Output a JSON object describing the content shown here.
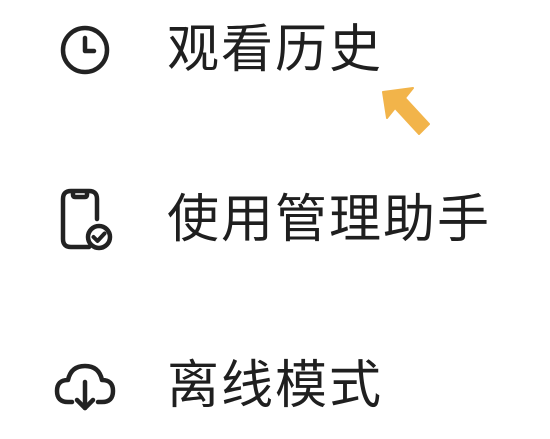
{
  "menu": {
    "items": [
      {
        "icon": "clock-icon",
        "label": "观看历史"
      },
      {
        "icon": "phone-check-icon",
        "label": "使用管理助手"
      },
      {
        "icon": "cloud-download-icon",
        "label": "离线模式"
      }
    ]
  },
  "colors": {
    "text": "#1f1f1f",
    "icon_stroke": "#222222",
    "pointer": "#f2b44a"
  }
}
